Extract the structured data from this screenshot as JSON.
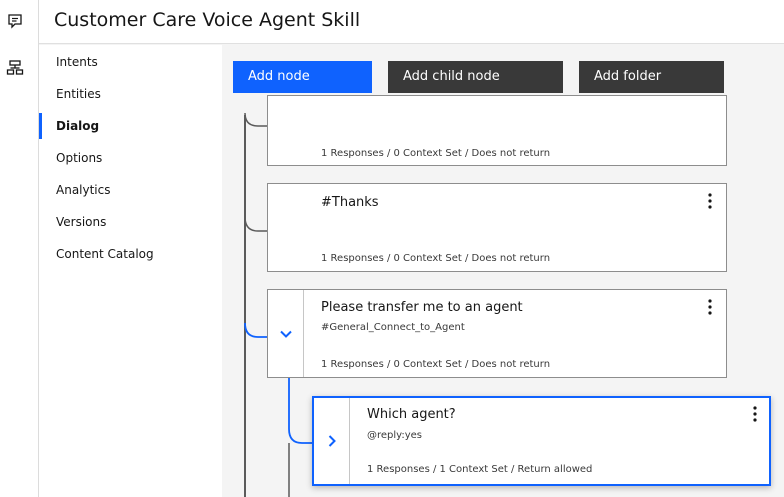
{
  "header": {
    "title": "Customer Care Voice Agent Skill"
  },
  "rail": [
    {
      "icon": "chat-bubble-icon"
    },
    {
      "icon": "dialog-tree-icon"
    }
  ],
  "sidebar": {
    "items": [
      {
        "label": "Intents"
      },
      {
        "label": "Entities"
      },
      {
        "label": "Dialog",
        "active": true
      },
      {
        "label": "Options"
      },
      {
        "label": "Analytics"
      },
      {
        "label": "Versions"
      },
      {
        "label": "Content Catalog"
      }
    ]
  },
  "toolbar": {
    "add_node": "Add node",
    "add_child_node": "Add child node",
    "add_folder": "Add folder"
  },
  "nodes": [
    {
      "title": "",
      "condition": "",
      "summary": "1 Responses / 0 Context Set / Does not return"
    },
    {
      "title": "#Thanks",
      "condition": "",
      "summary": "1 Responses / 0 Context Set / Does not return"
    },
    {
      "title": "Please transfer me to an agent",
      "condition": "#General_Connect_to_Agent",
      "summary": "1 Responses / 0 Context Set / Does not return"
    },
    {
      "title": "Which agent?",
      "condition": "@reply:yes",
      "summary": "1 Responses / 1 Context Set / Return allowed"
    }
  ],
  "colors": {
    "accent": "#0f62fe",
    "dark_button": "#393939",
    "connector": "#5a5a5a"
  }
}
